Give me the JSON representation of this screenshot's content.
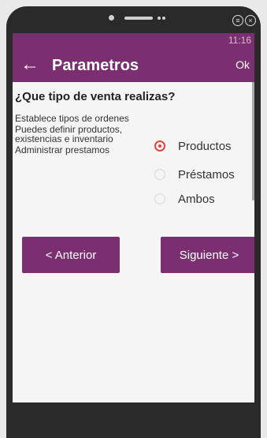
{
  "status": {
    "time": "11:16"
  },
  "appbar": {
    "back_icon": "←",
    "title": "Parametros",
    "ok_label": "Ok"
  },
  "question": "¿Que tipo de venta realizas?",
  "descriptions": [
    "Establece tipos de ordenes",
    "Puedes definir productos, existencias e inventario",
    "Administrar prestamos"
  ],
  "options": [
    {
      "label": "Productos",
      "selected": true
    },
    {
      "label": "Préstamos",
      "selected": false
    },
    {
      "label": "Ambos",
      "selected": false
    }
  ],
  "buttons": {
    "prev_label": "< Anterior",
    "next_label": "Siguiente >"
  },
  "colors": {
    "primary": "#7b2f70",
    "radio_selected": "#e0463c",
    "background": "#f5f5f5"
  }
}
